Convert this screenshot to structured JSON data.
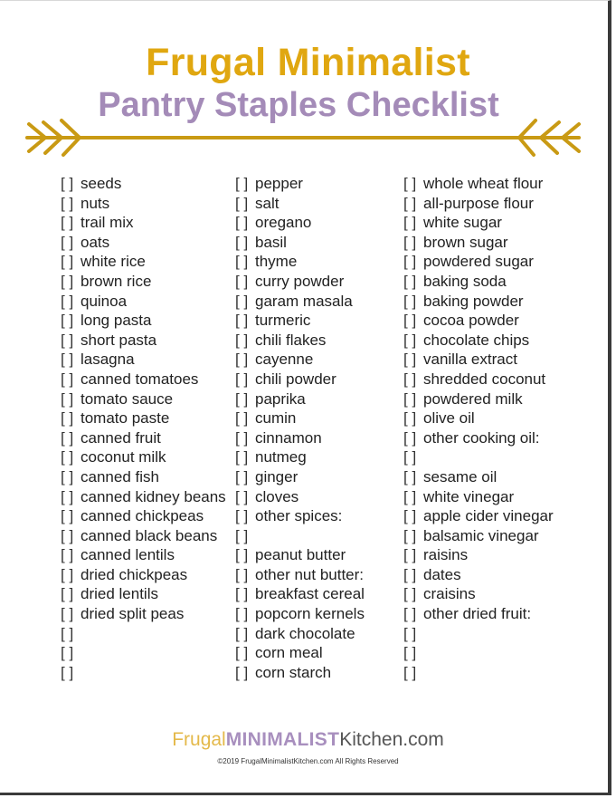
{
  "header": {
    "title": "Frugal Minimalist",
    "subtitle": "Pantry Staples Checklist",
    "accent_color": "#e0a710",
    "subtitle_color": "#a48bb8"
  },
  "checkbox_glyph": "[ ]",
  "columns": [
    {
      "items": [
        "seeds",
        "nuts",
        "trail mix",
        "oats",
        "white rice",
        "brown rice",
        "quinoa",
        "long pasta",
        "short pasta",
        "lasagna",
        "canned tomatoes",
        "tomato sauce",
        "tomato paste",
        "canned fruit",
        "coconut milk",
        "canned fish",
        "canned kidney beans",
        "canned chickpeas",
        "canned black beans",
        "canned lentils",
        "dried chickpeas",
        "dried lentils",
        "dried split peas",
        "",
        "",
        ""
      ]
    },
    {
      "items": [
        "pepper",
        "salt",
        "oregano",
        "basil",
        "thyme",
        "curry powder",
        "garam masala",
        "turmeric",
        "chili flakes",
        "cayenne",
        "chili powder",
        "paprika",
        "cumin",
        "cinnamon",
        "nutmeg",
        "ginger",
        "cloves",
        "other spices:",
        "",
        "peanut butter",
        "other nut butter:",
        "breakfast cereal",
        "popcorn kernels",
        "dark chocolate",
        "corn meal",
        "corn starch"
      ]
    },
    {
      "items": [
        "whole wheat flour",
        "all-purpose flour",
        "white sugar",
        "brown sugar",
        "powdered sugar",
        "baking soda",
        "baking powder",
        "cocoa powder",
        "chocolate chips",
        "vanilla extract",
        "shredded coconut",
        "powdered milk",
        "olive oil",
        "other cooking oil:",
        "",
        "sesame oil",
        "white vinegar",
        "apple cider vinegar",
        "balsamic vinegar",
        "raisins",
        "dates",
        "craisins",
        "other dried fruit:",
        "",
        "",
        ""
      ]
    }
  ],
  "footer": {
    "brand_part1": "Frugal",
    "brand_part2": "MINIMALIST",
    "brand_part3": "Kitchen.com",
    "copyright": "©2019 FrugalMinimalistKitchen.com All Rights Reserved"
  }
}
